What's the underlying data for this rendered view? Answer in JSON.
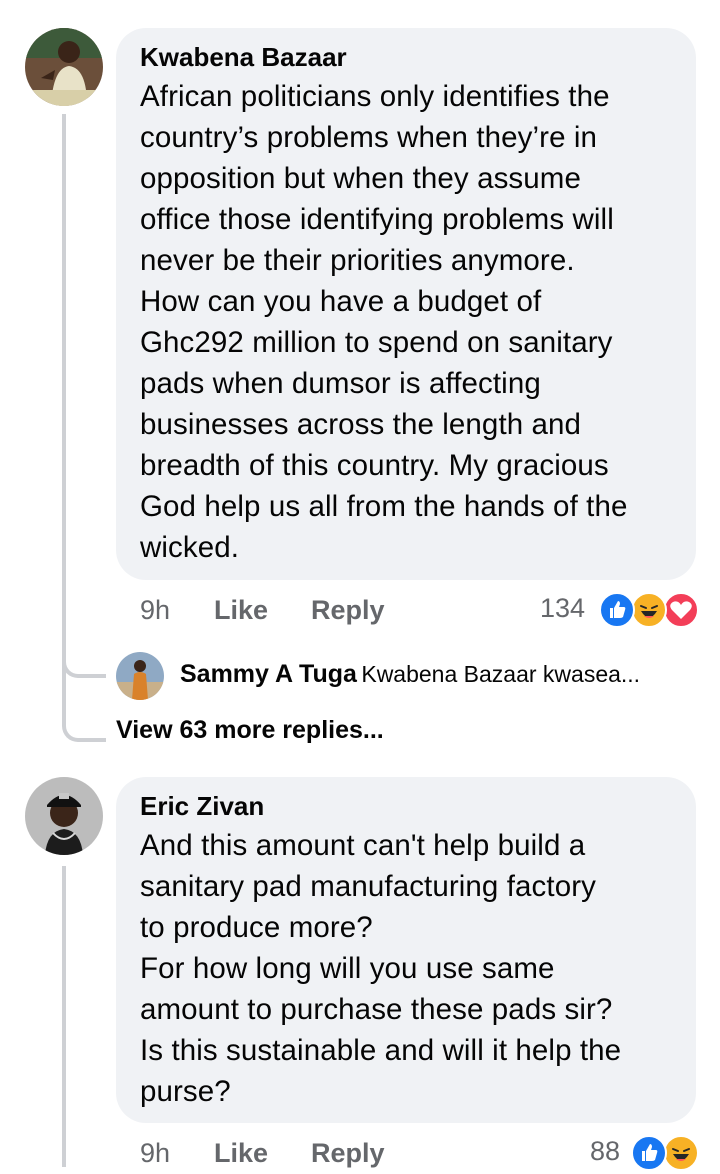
{
  "comments": [
    {
      "author": "Kwabena Bazaar",
      "text": "African politicians only identifies the\ncountry’s problems when they’re in\nopposition but when they assume\noffice those identifying problems will\nnever be their priorities anymore.\nHow can you have a budget of\nGhc292 million to spend on sanitary\npads when dumsor is affecting\nbusinesses across the length and\nbreadth of this country. My gracious\nGod help us all from the hands of the\nwicked.",
      "time": "9h",
      "like_label": "Like",
      "reply_label": "Reply",
      "reaction_count": "134",
      "reactions": [
        "like-icon",
        "haha-icon",
        "love-icon"
      ],
      "reply_preview": {
        "author": "Sammy A Tuga",
        "text": "Kwabena Bazaar kwasea..."
      },
      "view_more": "View 63 more replies..."
    },
    {
      "author": "Eric Zivan",
      "text": "And this amount can't help build a\nsanitary pad manufacturing factory\nto produce more?\nFor how long will you use same\namount to purchase these pads sir?\nIs this sustainable and will it help the\npurse?",
      "time": "9h",
      "like_label": "Like",
      "reply_label": "Reply",
      "reaction_count": "88",
      "reactions": [
        "like-icon",
        "haha-icon"
      ]
    }
  ],
  "colors": {
    "bubble": "#f0f2f5",
    "meta_text": "#65676b",
    "thread_line": "#ced0d4",
    "like_blue": "#1877f2",
    "haha_yellow": "#f7b125",
    "love_red": "#f33e58"
  }
}
